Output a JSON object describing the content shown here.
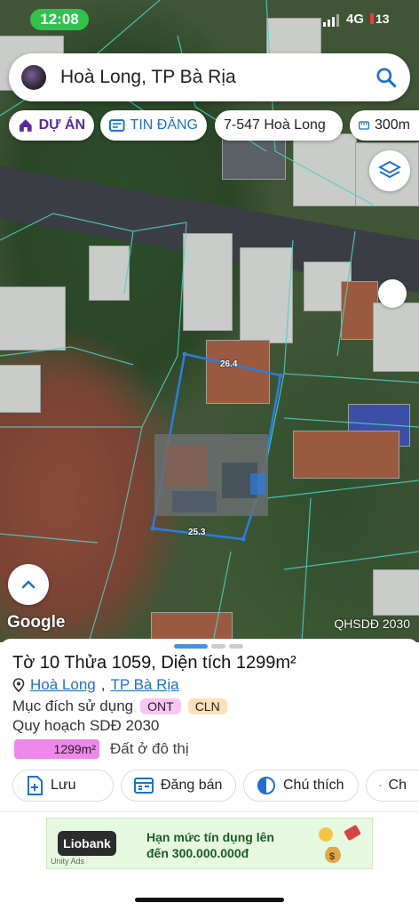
{
  "status_bar": {
    "time": "12:08",
    "network": "4G",
    "battery": "13"
  },
  "search": {
    "query": "Hoà Long, TP Bà Rịa"
  },
  "filter_chips": [
    {
      "label": "DỰ ÁN",
      "icon": "house-icon",
      "color": "#5b2c9a"
    },
    {
      "label": "TIN ĐĂNG",
      "icon": "listing-icon",
      "color": "#1d6fd4"
    },
    {
      "label": "7-547 Hoà Long",
      "icon": "",
      "color": "#222222"
    },
    {
      "label": "300m",
      "icon": "ruler-icon",
      "color": "#1d6fd4"
    }
  ],
  "map": {
    "google_label": "Google",
    "layer_label": "QHSDĐ 2030",
    "parcel_edge_top": "26.4",
    "parcel_edge_bottom": "25.3"
  },
  "sheet": {
    "title": "Tờ 10 Thửa 1059, Diện tích 1299m²",
    "location_commune": "Hoà Long",
    "location_city": "TP Bà Rịa",
    "usage_label": "Mục đích sử dụng",
    "usage_tags": [
      "ONT",
      "CLN"
    ],
    "plan_label": "Quy hoạch SDĐ 2030",
    "plan_area": "1299m²",
    "plan_type": "Đất ở đô thị",
    "actions": [
      {
        "label": "Lưu",
        "icon": "add-document-icon"
      },
      {
        "label": "Đăng bán",
        "icon": "listing-icon"
      },
      {
        "label": "Chú thích",
        "icon": "half-circle-icon"
      },
      {
        "label": "Ch",
        "icon": "camera-plus-icon"
      }
    ]
  },
  "ad": {
    "brand": "Liobank",
    "line1": "Hạn mức tín dụng lên",
    "line2": "đến 300.000.000đ",
    "network": "Unity Ads"
  },
  "colors": {
    "accent_blue": "#1d6fd4",
    "parcel_outline": "#2a7de1",
    "plan_pink": "#ee88ea"
  }
}
